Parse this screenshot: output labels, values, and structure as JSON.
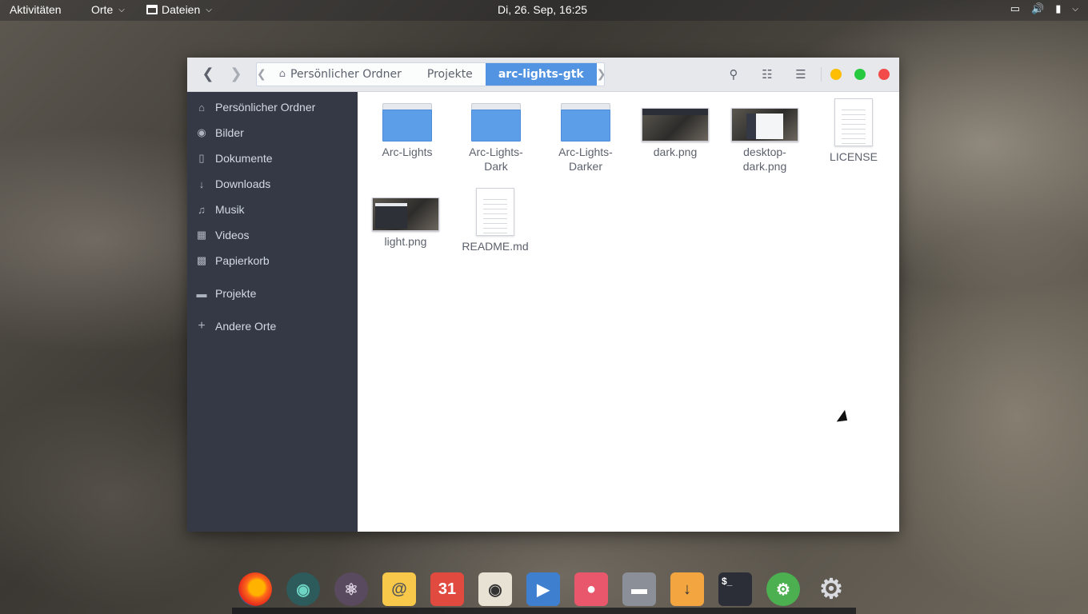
{
  "topbar": {
    "activities": "Aktivitäten",
    "places": "Orte",
    "app_menu": "Dateien",
    "clock": "Di, 26. Sep, 16:25",
    "tray_icons": [
      "display-icon",
      "volume-icon",
      "battery-icon",
      "system-menu-icon"
    ]
  },
  "window": {
    "pathbar": {
      "crumbs": [
        "Persönlicher Ordner",
        "Projekte",
        "arc-lights-gtk"
      ],
      "active_index": 2
    },
    "header_buttons": [
      "search-icon",
      "view-list-icon",
      "menu-icon"
    ],
    "window_controls": {
      "minimize_color": "#fdbe04",
      "maximize_color": "#27c93f",
      "close_color": "#f34a4a"
    }
  },
  "sidebar": {
    "items": [
      {
        "label": "Persönlicher Ordner",
        "icon": "home-icon"
      },
      {
        "label": "Bilder",
        "icon": "camera-icon"
      },
      {
        "label": "Dokumente",
        "icon": "document-icon"
      },
      {
        "label": "Downloads",
        "icon": "download-icon"
      },
      {
        "label": "Musik",
        "icon": "music-icon"
      },
      {
        "label": "Videos",
        "icon": "film-icon"
      },
      {
        "label": "Papierkorb",
        "icon": "trash-icon"
      },
      {
        "label": "Projekte",
        "icon": "folder-icon"
      },
      {
        "label": "Andere Orte",
        "icon": "plus-icon"
      }
    ]
  },
  "files": [
    {
      "name": "Arc-Lights",
      "type": "folder"
    },
    {
      "name": "Arc-Lights-Dark",
      "type": "folder"
    },
    {
      "name": "Arc-Lights-Darker",
      "type": "folder"
    },
    {
      "name": "dark.png",
      "type": "image"
    },
    {
      "name": "desktop-dark.png",
      "type": "image"
    },
    {
      "name": "LICENSE",
      "type": "text"
    },
    {
      "name": "light.png",
      "type": "image"
    },
    {
      "name": "README.md",
      "type": "text"
    }
  ],
  "file_labels": {
    "f0": "Arc-Lights",
    "f1": "Arc-Lights-Dark",
    "f2": "Arc-Lights-Darker",
    "f3": "dark.png",
    "f4": "desktop-dark.png",
    "f5": "LICENSE",
    "f6": "light.png",
    "f7": "README.md"
  },
  "dock": {
    "apps": [
      "firefox-icon",
      "gitkraken-icon",
      "atom-icon",
      "mail-icon",
      "calendar-icon",
      "rhythmbox-icon",
      "video-player-icon",
      "photos-icon",
      "files-icon",
      "download-manager-icon",
      "terminal-icon",
      "software-settings-icon",
      "settings-icon"
    ],
    "calendar_day": "31",
    "terminal_prompt": "$_"
  },
  "colors": {
    "accent": "#5294e2",
    "sidebar_bg": "#353945",
    "headerbar_bg": "#e7e8eb"
  }
}
